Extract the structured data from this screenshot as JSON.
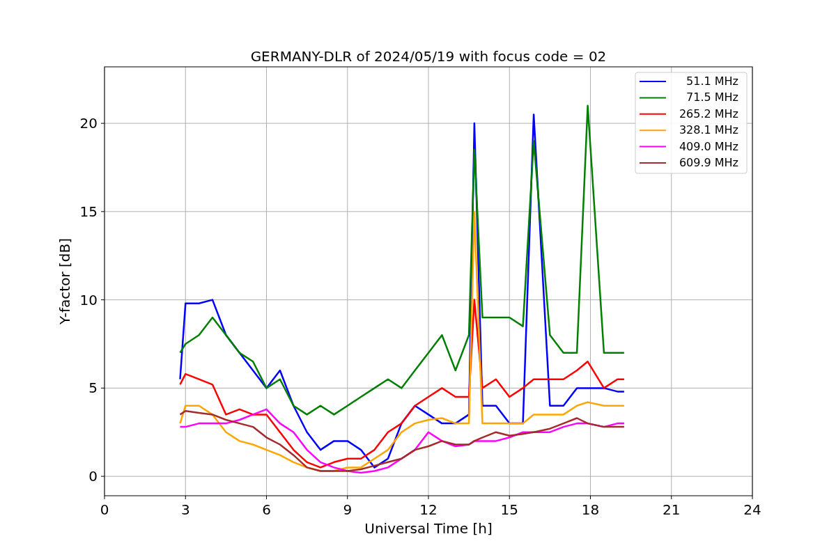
{
  "chart_data": {
    "type": "line",
    "title": "GERMANY-DLR of 2024/05/19 with focus code = 02",
    "xlabel": "Universal Time [h]",
    "ylabel": "Y-factor [dB]",
    "x": [
      2.8,
      3,
      3.5,
      4,
      4.5,
      5,
      5.5,
      6,
      6.5,
      7,
      7.5,
      8,
      8.5,
      9,
      9.5,
      10,
      10.5,
      11,
      11.5,
      12,
      12.5,
      13,
      13.5,
      13.7,
      14,
      14.5,
      15,
      15.5,
      15.9,
      16.5,
      17,
      17.5,
      17.9,
      18.5,
      19,
      19.25
    ],
    "series": [
      {
        "name": "51.1 MHz",
        "color": "#0000ff",
        "values": [
          5.5,
          9.8,
          9.8,
          10,
          8,
          7,
          6,
          5,
          6,
          4,
          2.5,
          1.5,
          2,
          2,
          1.5,
          0.5,
          1,
          3,
          4,
          3.5,
          3,
          3,
          3.5,
          20,
          4,
          4,
          3,
          3,
          20.5,
          4,
          4,
          5,
          5,
          5,
          4.8,
          4.8
        ]
      },
      {
        "name": "71.5 MHz",
        "color": "#008000",
        "values": [
          7,
          7.5,
          8,
          9,
          8,
          7,
          6.5,
          5,
          5.5,
          4,
          3.5,
          4,
          3.5,
          4,
          4.5,
          5,
          5.5,
          5,
          6,
          7,
          8,
          6,
          8,
          18.5,
          9,
          9,
          9,
          8.5,
          19,
          8,
          7,
          7,
          21,
          7,
          7,
          7
        ]
      },
      {
        "name": "265.2 MHz",
        "color": "#ff0000",
        "values": [
          5.2,
          5.8,
          5.5,
          5.2,
          3.5,
          3.8,
          3.5,
          3.5,
          2.5,
          1.5,
          0.8,
          0.5,
          0.8,
          1,
          1,
          1.5,
          2.5,
          3,
          4,
          4.5,
          5,
          4.5,
          4.5,
          10,
          5,
          5.5,
          4.5,
          5,
          5.5,
          5.5,
          5.5,
          6,
          6.5,
          5,
          5.5,
          5.5
        ]
      },
      {
        "name": "328.1 MHz",
        "color": "#ffa500",
        "values": [
          3,
          4,
          4,
          3.5,
          2.5,
          2,
          1.8,
          1.5,
          1.2,
          0.8,
          0.5,
          0.3,
          0.3,
          0.5,
          0.5,
          1,
          1.5,
          2.5,
          3,
          3.2,
          3.3,
          3,
          3,
          15,
          3,
          3,
          3,
          3,
          3.5,
          3.5,
          3.5,
          4,
          4.2,
          4,
          4,
          4
        ]
      },
      {
        "name": "409.0 MHz",
        "color": "#ff00ff",
        "values": [
          2.8,
          2.8,
          3,
          3,
          3,
          3.2,
          3.5,
          3.8,
          3,
          2.5,
          1.5,
          0.8,
          0.5,
          0.3,
          0.2,
          0.3,
          0.5,
          1,
          1.5,
          2.5,
          2,
          1.7,
          1.8,
          2,
          2,
          2,
          2.2,
          2.5,
          2.5,
          2.5,
          2.8,
          3,
          3,
          2.8,
          3,
          3
        ]
      },
      {
        "name": "609.9 MHz",
        "color": "#a52a2a",
        "values": [
          3.5,
          3.7,
          3.6,
          3.5,
          3.2,
          3,
          2.8,
          2.2,
          1.8,
          1.2,
          0.5,
          0.3,
          0.3,
          0.3,
          0.4,
          0.6,
          0.8,
          1,
          1.5,
          1.7,
          2,
          1.8,
          1.8,
          2,
          2.2,
          2.5,
          2.3,
          2.4,
          2.5,
          2.7,
          3,
          3.3,
          3,
          2.8,
          2.8,
          2.8
        ]
      }
    ],
    "grid": true,
    "legend": true,
    "xlim": [
      0,
      24
    ],
    "ylim": [
      -1.1,
      23.2
    ],
    "xticks": [
      0,
      3,
      6,
      9,
      12,
      15,
      18,
      21,
      24
    ],
    "yticks": [
      0,
      5,
      10,
      15,
      20
    ]
  }
}
